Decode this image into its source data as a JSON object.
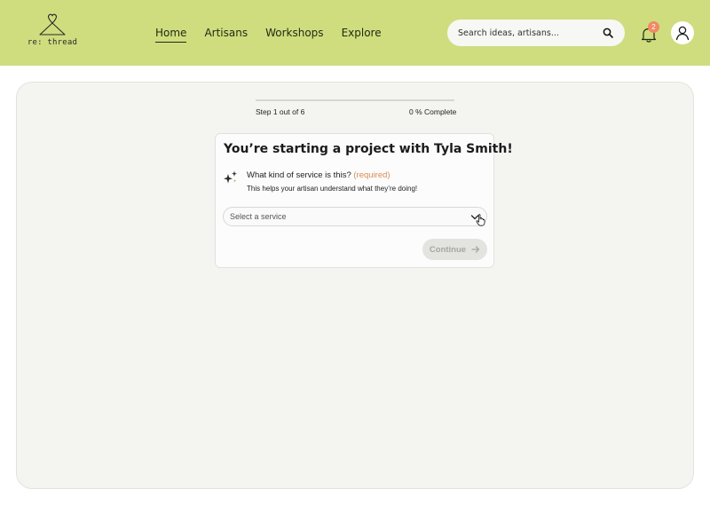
{
  "brand": {
    "name": "re: thread",
    "header_color": "#cfdd7e"
  },
  "nav": {
    "items": [
      {
        "label": "Home",
        "active": true
      },
      {
        "label": "Artisans",
        "active": false
      },
      {
        "label": "Workshops",
        "active": false
      },
      {
        "label": "Explore",
        "active": false
      }
    ]
  },
  "search": {
    "placeholder": "Search ideas, artisans...",
    "icon": "search-icon"
  },
  "notifications": {
    "count": "2",
    "icon": "bell-icon",
    "badge_color": "#f08a65"
  },
  "account": {
    "icon": "user-icon"
  },
  "progress": {
    "step_text": "Step 1 out of 6",
    "percent_text": "0 % Complete",
    "fraction": 0
  },
  "card": {
    "title": "You’re starting a project with Tyla Smith!",
    "question": "What kind of service is this?",
    "required": "(required)",
    "helper": "This helps your artisan understand what they’re doing!",
    "select_placeholder": "Select a service",
    "continue_label": "Continue",
    "accent_required": "#d98a52"
  }
}
